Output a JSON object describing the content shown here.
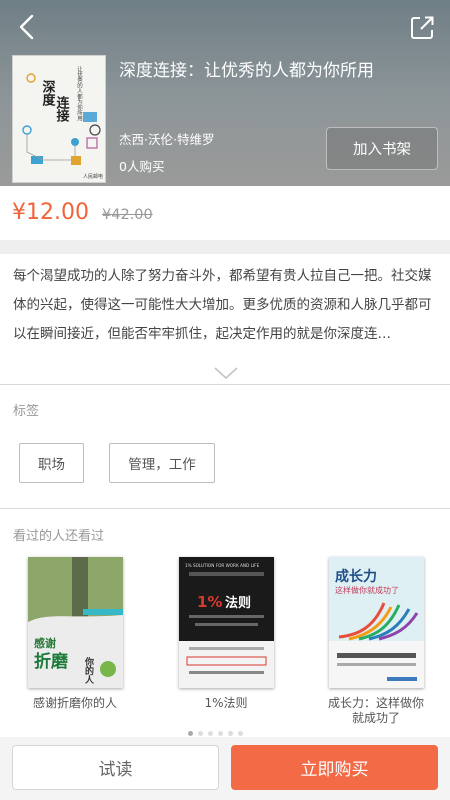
{
  "header": {
    "title": "深度连接：让优秀的人都为你所用",
    "author": "杰西·沃伦·特维罗",
    "buyers": "0人购买",
    "shelf_button": "加入书架",
    "cover_title": "深度连接",
    "cover_subtitle": "让优秀的人都为你所用",
    "back_icon": "back-arrow-icon",
    "share_icon": "share-icon"
  },
  "price": {
    "current": "¥12.00",
    "original": "¥42.00",
    "accent_color": "#f26339"
  },
  "description": "每个渴望成功的人除了努力奋斗外，都希望有贵人拉自己一把。社交媒体的兴起，使得这一可能性大大增加。更多优质的资源和人脉几乎都可以在瞬间接近，但能否牢牢抓住，起决定作用的就是你深度连…",
  "tags": {
    "label": "标签",
    "items": [
      "职场",
      "管理，工作"
    ]
  },
  "recommendations": {
    "label": "看过的人还看过",
    "items": [
      {
        "name": "感谢折磨你的人",
        "cover_text": "感谢折磨你的人"
      },
      {
        "name": "1%法则",
        "cover_text": "1%法则",
        "cover_en": "1% SOLUTION FOR WORK AND LIFE"
      },
      {
        "name": "成长力：这样做你就成功了",
        "cover_text": "成长力",
        "cover_sub": "这样做你就成功了"
      }
    ],
    "page_dots": 6,
    "active_dot": 0
  },
  "bottom": {
    "try_label": "试读",
    "buy_label": "立即购买",
    "buy_color": "#f26a46"
  }
}
